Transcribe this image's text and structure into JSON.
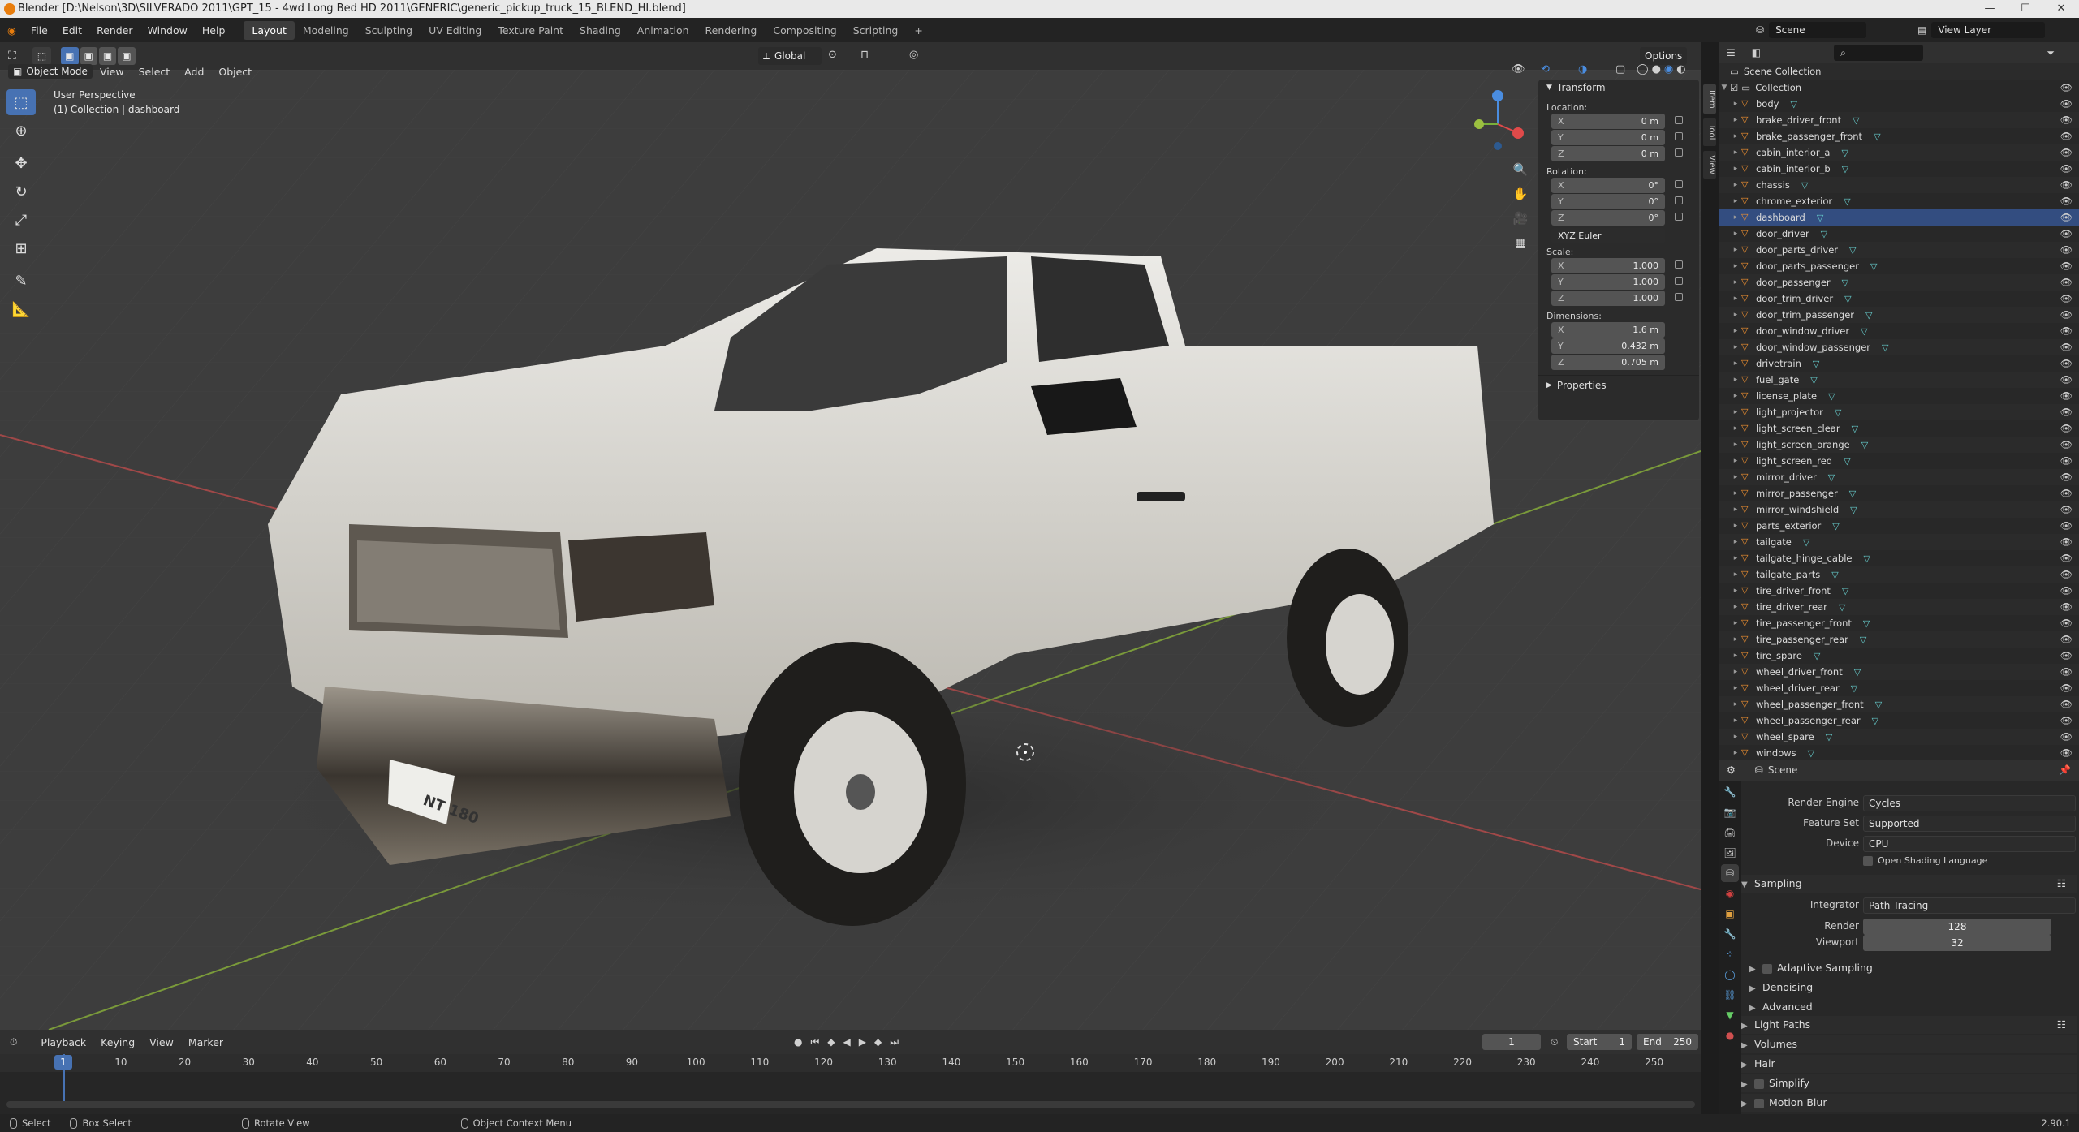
{
  "window": {
    "title": "Blender [D:\\Nelson\\3D\\SILVERADO 2011\\GPT_15 - 4wd Long Bed HD 2011\\GENERIC\\generic_pickup_truck_15_BLEND_HI.blend]",
    "controls": [
      "—",
      "☐",
      "✕"
    ]
  },
  "menu": {
    "items": [
      "File",
      "Edit",
      "Render",
      "Window",
      "Help"
    ],
    "workspaces": [
      "Layout",
      "Modeling",
      "Sculpting",
      "UV Editing",
      "Texture Paint",
      "Shading",
      "Animation",
      "Rendering",
      "Compositing",
      "Scripting"
    ],
    "active_workspace": "Layout",
    "add_tab": "+",
    "scene": "Scene",
    "view_layer": "View Layer"
  },
  "viewport_header": {
    "mode": "Object Mode",
    "menus": [
      "View",
      "Select",
      "Add",
      "Object"
    ],
    "orientation": "Global",
    "options": "Options"
  },
  "viewport": {
    "perspective": "User Perspective",
    "collection_info": "(1) Collection | dashboard",
    "license_plate": "NT 180"
  },
  "npanel": {
    "tabs": [
      "Item",
      "Tool",
      "View"
    ],
    "transform_title": "Transform",
    "location_label": "Location:",
    "location": [
      {
        "ax": "X",
        "v": "0 m"
      },
      {
        "ax": "Y",
        "v": "0 m"
      },
      {
        "ax": "Z",
        "v": "0 m"
      }
    ],
    "rotation_label": "Rotation:",
    "rotation": [
      {
        "ax": "X",
        "v": "0°"
      },
      {
        "ax": "Y",
        "v": "0°"
      },
      {
        "ax": "Z",
        "v": "0°"
      }
    ],
    "rotation_mode": "XYZ Euler",
    "scale_label": "Scale:",
    "scale": [
      {
        "ax": "X",
        "v": "1.000"
      },
      {
        "ax": "Y",
        "v": "1.000"
      },
      {
        "ax": "Z",
        "v": "1.000"
      }
    ],
    "dimensions_label": "Dimensions:",
    "dimensions": [
      {
        "ax": "X",
        "v": "1.6 m"
      },
      {
        "ax": "Y",
        "v": "0.432 m"
      },
      {
        "ax": "Z",
        "v": "0.705 m"
      }
    ],
    "properties_title": "Properties"
  },
  "outliner": {
    "scene_collection": "Scene Collection",
    "collection": "Collection",
    "objects": [
      "body",
      "brake_driver_front",
      "brake_passenger_front",
      "cabin_interior_a",
      "cabin_interior_b",
      "chassis",
      "chrome_exterior",
      "dashboard",
      "door_driver",
      "door_parts_driver",
      "door_parts_passenger",
      "door_passenger",
      "door_trim_driver",
      "door_trim_passenger",
      "door_window_driver",
      "door_window_passenger",
      "drivetrain",
      "fuel_gate",
      "license_plate",
      "light_projector",
      "light_screen_clear",
      "light_screen_orange",
      "light_screen_red",
      "mirror_driver",
      "mirror_passenger",
      "mirror_windshield",
      "parts_exterior",
      "tailgate",
      "tailgate_hinge_cable",
      "tailgate_parts",
      "tire_driver_front",
      "tire_driver_rear",
      "tire_passenger_front",
      "tire_passenger_rear",
      "tire_spare",
      "wheel_driver_front",
      "wheel_driver_rear",
      "wheel_passenger_front",
      "wheel_passenger_rear",
      "wheel_spare",
      "windows"
    ],
    "selected": "dashboard"
  },
  "properties": {
    "context": "Scene",
    "render_engine_label": "Render Engine",
    "render_engine": "Cycles",
    "feature_set_label": "Feature Set",
    "feature_set": "Supported",
    "device_label": "Device",
    "device": "CPU",
    "osl_label": "Open Shading Language",
    "sampling": "Sampling",
    "integrator_label": "Integrator",
    "integrator": "Path Tracing",
    "render_label": "Render",
    "render_samples": "128",
    "viewport_label": "Viewport",
    "viewport_samples": "32",
    "sub_sections": [
      "Adaptive Sampling",
      "Denoising",
      "Advanced"
    ],
    "sections": [
      "Light Paths",
      "Volumes",
      "Hair",
      "Simplify",
      "Motion Blur"
    ]
  },
  "timeline": {
    "menus": [
      "Playback",
      "Keying",
      "View",
      "Marker"
    ],
    "current_frame": "1",
    "start_label": "Start",
    "start": "1",
    "end_label": "End",
    "end": "250",
    "ticks": [
      "1",
      "10",
      "20",
      "30",
      "40",
      "50",
      "60",
      "70",
      "80",
      "90",
      "100",
      "110",
      "120",
      "130",
      "140",
      "150",
      "160",
      "170",
      "180",
      "190",
      "200",
      "210",
      "220",
      "230",
      "240",
      "250"
    ]
  },
  "statusbar": {
    "select": "Select",
    "box_select": "Box Select",
    "rotate_view": "Rotate View",
    "context_menu": "Object Context Menu",
    "version": "2.90.1"
  },
  "colors": {
    "accent": "#4772b3",
    "object_icon": "#f09030",
    "mesh_icon": "#66cccc",
    "truck_body": "#d8d5ce"
  }
}
